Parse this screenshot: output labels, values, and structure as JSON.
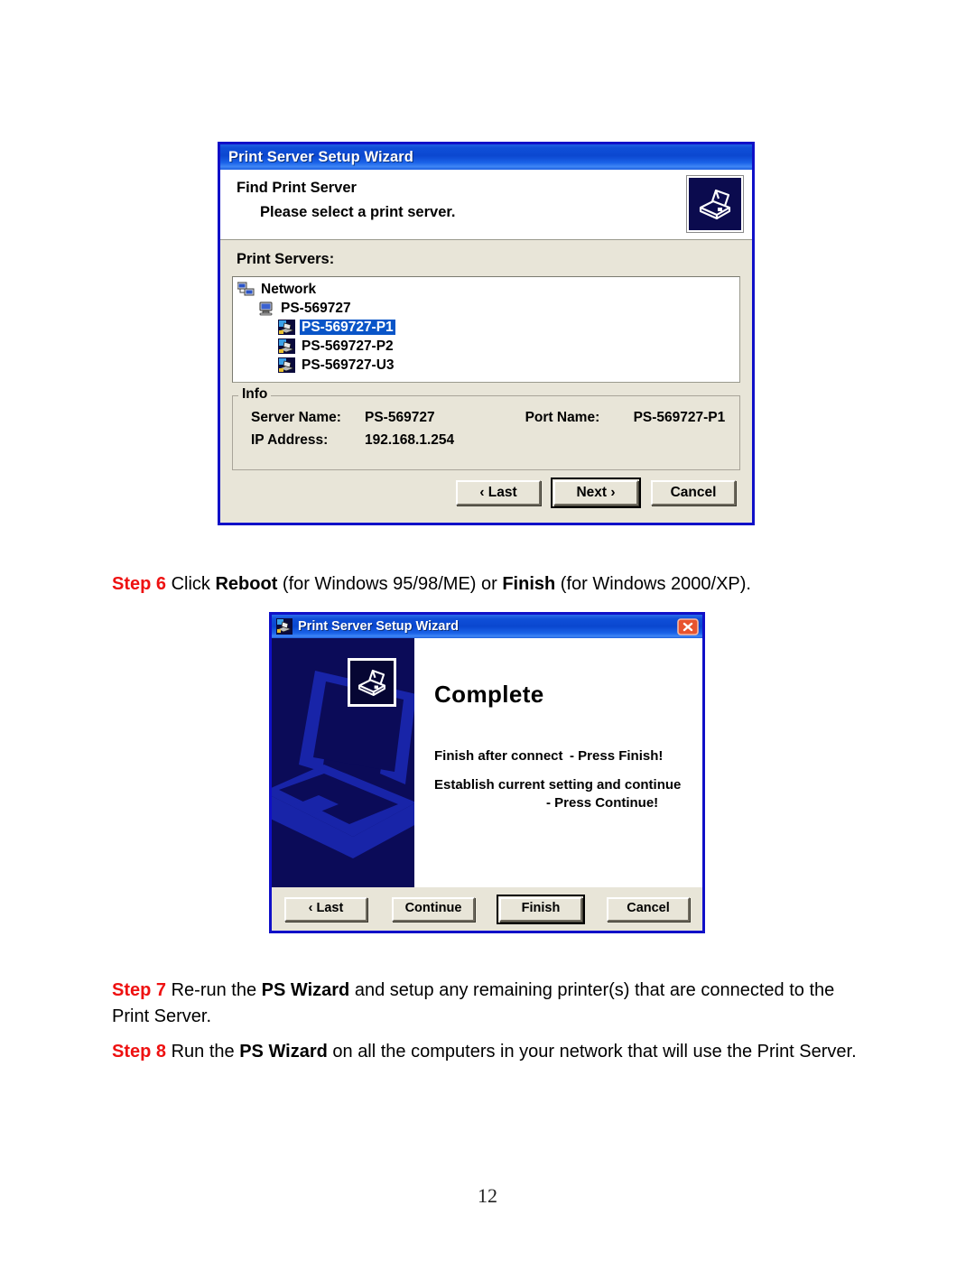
{
  "document": {
    "page_number": "12"
  },
  "dialog1": {
    "title": "Print Server Setup Wizard",
    "header_line1": "Find Print Server",
    "header_line2": "Please select a print server.",
    "header_icon": "printer-icon",
    "list_label": "Print Servers:",
    "tree": [
      {
        "label": "Network",
        "level": 0,
        "icon": "network-icon",
        "selected": false
      },
      {
        "label": "PS-569727",
        "level": 1,
        "icon": "computer-icon",
        "selected": false
      },
      {
        "label": "PS-569727-P1",
        "level": 2,
        "icon": "printer-port-icon",
        "selected": true
      },
      {
        "label": "PS-569727-P2",
        "level": 2,
        "icon": "printer-port-icon",
        "selected": false
      },
      {
        "label": "PS-569727-U3",
        "level": 2,
        "icon": "printer-port-icon",
        "selected": false
      }
    ],
    "info": {
      "legend": "Info",
      "server_name_label": "Server Name:",
      "server_name_value": "PS-569727",
      "port_name_label": "Port Name:",
      "port_name_value": "PS-569727-P1",
      "ip_address_label": "IP Address:",
      "ip_address_value": "192.168.1.254"
    },
    "buttons": {
      "last": "‹ Last",
      "next": "Next ›",
      "cancel": "Cancel"
    }
  },
  "step6": {
    "num": "Step 6",
    "t1": " Click ",
    "b1": "Reboot",
    "t2": " (for Windows 95/98/ME) or ",
    "b2": "Finish",
    "t3": " (for Windows 2000/XP)."
  },
  "dialog2": {
    "title": "Print Server Setup Wizard",
    "title_icon": "printer-icon",
    "close_icon": "close-icon",
    "side_icon": "printer-icon",
    "heading": "Complete",
    "message_line1_a": "Finish after connect",
    "message_line1_b": "- Press Finish!",
    "message_line2": "Establish current setting and continue",
    "message_line3": "- Press Continue!",
    "buttons": {
      "last": "‹ Last",
      "continue": "Continue",
      "finish": "Finish",
      "cancel": "Cancel"
    }
  },
  "step7": {
    "num": "Step 7",
    "t1": " Re-run the ",
    "b1": "PS Wizard",
    "t2": " and setup any remaining printer(s) that are connected to the Print Server."
  },
  "step8": {
    "num": "Step 8",
    "t1": " Run the ",
    "b1": "PS Wizard",
    "t2": " on all the computers in your network that will use the Print Server."
  },
  "colors": {
    "titlebar_blue": "#0b47d0",
    "dialog_border": "#1010c8",
    "dialog_face": "#e8e5d8",
    "selection_blue": "#0a55c8",
    "step_red": "#ee1111",
    "side_panel_navy": "#0b0b58",
    "close_red": "#e04a32"
  }
}
